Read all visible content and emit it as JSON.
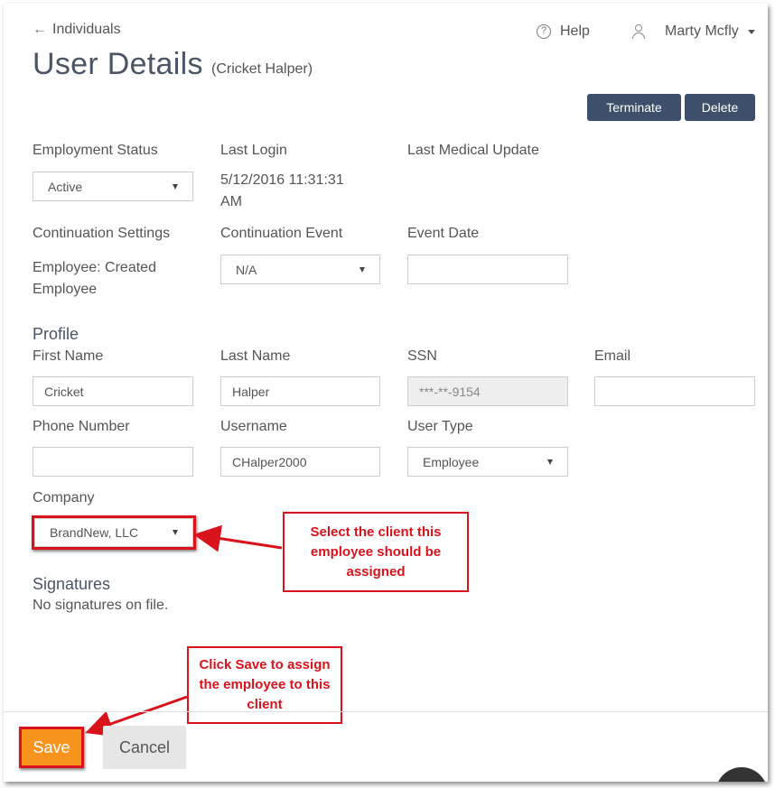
{
  "nav": {
    "back_label": "Individuals"
  },
  "header": {
    "title": "User Details",
    "subtitle": "(Cricket Halper)",
    "help_label": "Help",
    "user_name": "Marty Mcfly"
  },
  "actions": {
    "terminate_label": "Terminate",
    "delete_label": "Delete"
  },
  "employment": {
    "status_label": "Employment Status",
    "status_value": "Active",
    "last_login_label": "Last Login",
    "last_login_value": "5/12/2016 11:31:31 AM",
    "last_medical_label": "Last Medical Update"
  },
  "continuation": {
    "settings_label": "Continuation Settings",
    "settings_value": "Employee: Created Employee",
    "event_label": "Continuation Event",
    "event_value": "N/A",
    "event_date_label": "Event Date",
    "event_date_value": ""
  },
  "profile": {
    "section_title": "Profile",
    "first_name_label": "First Name",
    "first_name_value": "Cricket",
    "last_name_label": "Last Name",
    "last_name_value": "Halper",
    "ssn_label": "SSN",
    "ssn_value": "***-**-9154",
    "email_label": "Email",
    "email_value": "",
    "phone_label": "Phone Number",
    "phone_value": "",
    "username_label": "Username",
    "username_value": "CHalper2000",
    "user_type_label": "User Type",
    "user_type_value": "Employee",
    "company_label": "Company",
    "company_value": "BrandNew, LLC"
  },
  "signatures": {
    "section_title": "Signatures",
    "empty_text": "No signatures on file."
  },
  "annotations": {
    "company_callout": "Select the client this employee should be assigned",
    "save_callout": "Click Save to assign the employee to this client",
    "color": "#d9121c"
  },
  "footer": {
    "save_label": "Save",
    "cancel_label": "Cancel"
  },
  "colors": {
    "primary_dark": "#3d4f6a",
    "save_orange": "#f7941d"
  }
}
